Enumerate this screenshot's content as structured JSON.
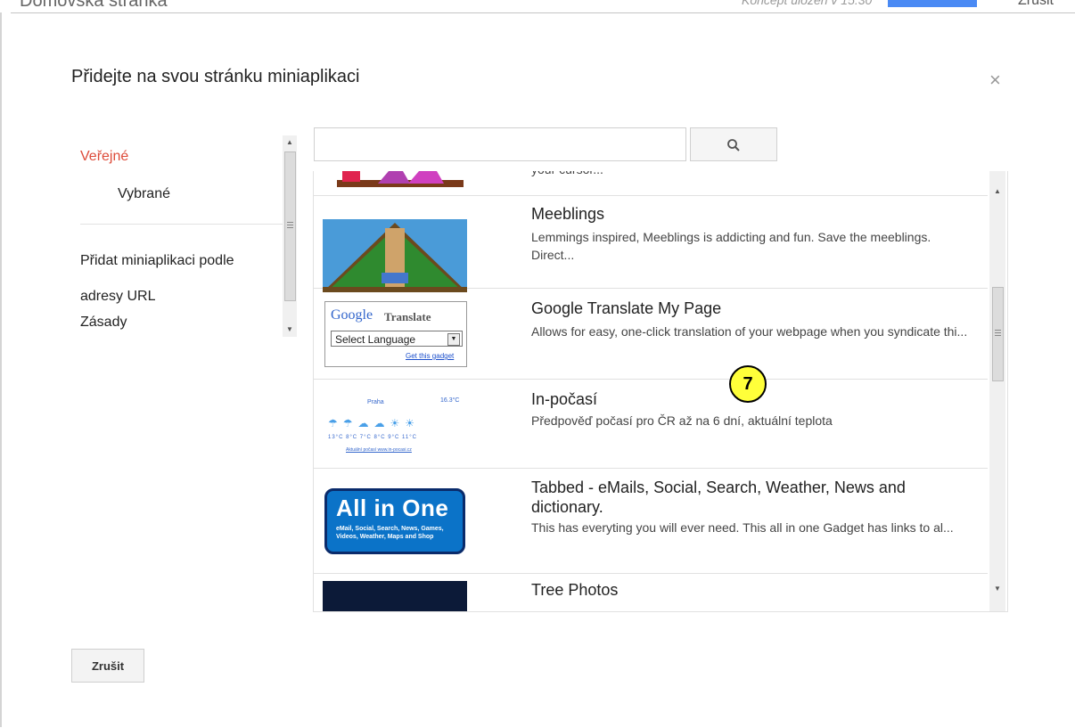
{
  "background": {
    "page_title": "Domovská stránka",
    "saved_text": "Koncept uložen v 15:30",
    "cancel": "Zrušit"
  },
  "dialog": {
    "title": "Přidejte na svou stránku miniaplikaci",
    "close_label": "×"
  },
  "nav": {
    "public": "Veřejné",
    "featured": "Vybrané",
    "add_by_url": "Přidat miniaplikaci podle adresy URL",
    "policies": "Zásady"
  },
  "search": {
    "placeholder": "",
    "value": ""
  },
  "gadgets": [
    {
      "title": "",
      "desc": "your cursor..."
    },
    {
      "title": "Meeblings",
      "desc": "Lemmings inspired, Meeblings is addicting and fun. Save the meeblings. Direct..."
    },
    {
      "title": "Google Translate My Page",
      "desc": "Allows for easy, one-click translation of your webpage when you syndicate thi..."
    },
    {
      "title": "In-počasí",
      "desc": "Předpověď počasí pro ČR až na 6 dní, aktuální teplota"
    },
    {
      "title": "Tabbed - eMails, Social, Search, Weather, News and dictionary.",
      "desc": "This has everyting you will ever need. This all in one Gadget has links to al..."
    },
    {
      "title": "Tree Photos",
      "desc": ""
    }
  ],
  "thumbs": {
    "gt_logo": "Google",
    "gt_translate": "Translate",
    "gt_select": "Select Language",
    "gt_link": "Get this gadget",
    "wx_city": "Praha",
    "wx_temp": "16.3°C",
    "wx_temps": "13°C  8°C  7°C  8°C  9°C  11°C",
    "wx_foot": "Aktuální počasí www.in-pocasi.cz",
    "aio_big": "All in One",
    "aio_small": "eMail, Social, Search, News, Games, Videos, Weather, Maps and Shop"
  },
  "marker": "7",
  "cancel_button": "Zrušit",
  "colors": {
    "active_nav": "#dd4b39",
    "marker_fill": "#ffff3a",
    "aio_blue": "#0b73c8"
  }
}
